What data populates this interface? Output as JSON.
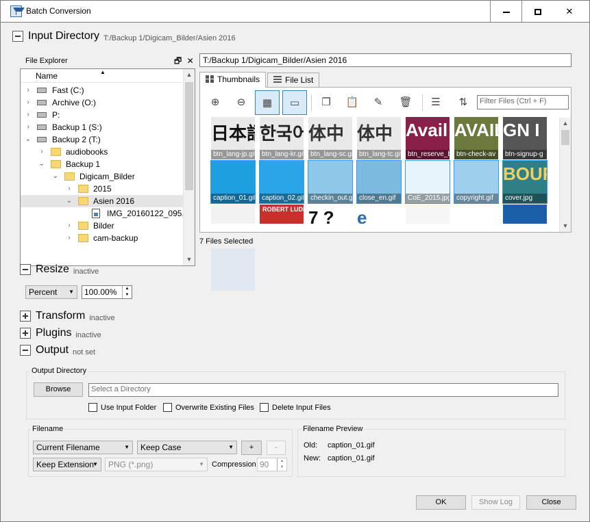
{
  "window": {
    "title": "Batch Conversion",
    "min_label": "",
    "close_label": "✕"
  },
  "input_directory": {
    "title": "Input Directory",
    "path": "T:/Backup 1/Digicam_Bilder/Asien 2016"
  },
  "file_explorer": {
    "label": "File Explorer",
    "column_header": "Name",
    "items": [
      {
        "label": "Fast (C:)",
        "type": "drive"
      },
      {
        "label": "Archive (O:)",
        "type": "drive"
      },
      {
        "label": "P:",
        "type": "drive"
      },
      {
        "label": "Backup 1 (S:)",
        "type": "drive"
      },
      {
        "label": "Backup 2 (T:)",
        "type": "drive"
      },
      {
        "label": "audiobooks",
        "type": "folder"
      },
      {
        "label": "Backup 1",
        "type": "folder"
      },
      {
        "label": "Digicam_Bilder",
        "type": "folder"
      },
      {
        "label": "2015",
        "type": "folder"
      },
      {
        "label": "Asien 2016",
        "type": "folder",
        "selected": true
      },
      {
        "label": "IMG_20160122_095...",
        "type": "file"
      },
      {
        "label": "Bilder",
        "type": "folder"
      },
      {
        "label": "cam-backup",
        "type": "folder"
      }
    ]
  },
  "path_field": "T:/Backup 1/Digicam_Bilder/Asien 2016",
  "tabs": [
    {
      "label": "Thumbnails",
      "active": true
    },
    {
      "label": "File List",
      "active": false
    }
  ],
  "toolbar": {
    "icons": [
      "zoom-in-icon",
      "zoom-out-icon",
      "grid-view-icon",
      "single-view-icon",
      "copy-icon",
      "paste-icon",
      "edit-icon",
      "delete-icon",
      "list-icon",
      "sort-icon"
    ],
    "filter_placeholder": "Filter Files (Ctrl + F)"
  },
  "thumbnails": [
    {
      "caption": "btn_lang-jp.gif",
      "text": "日本語",
      "bg": "#e9e9e9",
      "fg": "#111111"
    },
    {
      "caption": "btn_lang-kr.gif",
      "text": "한국어",
      "bg": "#e9e9e9",
      "fg": "#222222"
    },
    {
      "caption": "btn_lang-sc.gif",
      "text": "体中",
      "bg": "#e9e9e9",
      "fg": "#333333"
    },
    {
      "caption": "btn_lang-tc.gif",
      "text": "体中",
      "bg": "#e9e9e9",
      "fg": "#333333"
    },
    {
      "caption": "btn_reserve_b",
      "text": "Avail",
      "bg": "#8a1f4a",
      "fg": "#ffffff"
    },
    {
      "caption": "btn-check-av",
      "text": "AVAIL",
      "bg": "#6b7a3c",
      "fg": "#ffffff"
    },
    {
      "caption": "btn-signup-g",
      "text": "GN I",
      "bg": "#555555",
      "fg": "#ffffff"
    },
    {
      "caption": "caption_01.gif",
      "text": "",
      "bg": "#1e9fe0",
      "fg": "#ffffff"
    },
    {
      "caption": "caption_02.gif",
      "text": "",
      "bg": "#2aa5e5",
      "fg": "#ffffff"
    },
    {
      "caption": "checkin_out.gif",
      "text": "",
      "bg": "#8dc8e8",
      "fg": "#ffffff"
    },
    {
      "caption": "close_en.gif",
      "text": "",
      "bg": "#7cbbe0",
      "fg": "#ffffff"
    },
    {
      "caption": "CoE_2015.jpg",
      "text": "",
      "bg": "#e6f3f8",
      "fg": "#333333"
    },
    {
      "caption": "copyright.gif",
      "text": "",
      "bg": "#9ed0ee",
      "fg": "#ffffff"
    },
    {
      "caption": "cover.jpg",
      "text": "BOURNE",
      "bg": "#2f7f86",
      "fg": "#f0d060"
    },
    {
      "caption": "",
      "text": "",
      "bg": "#f2f2f2",
      "fg": "#c0392b"
    },
    {
      "caption": "",
      "text": "ROBERT LUDLUMS",
      "bg": "#c9302c",
      "fg": "#ffffff"
    },
    {
      "caption": "",
      "text": "7 ?",
      "bg": "#ffffff",
      "fg": "#111111"
    },
    {
      "caption": "",
      "text": "e",
      "bg": "#ffffff",
      "fg": "#2a6fb0"
    },
    {
      "caption": "",
      "text": "",
      "bg": "#f5f5f5",
      "fg": "#888888"
    },
    {
      "caption": "",
      "text": "",
      "bg": "#ffffff",
      "fg": "#333333"
    },
    {
      "caption": "",
      "text": "",
      "bg": "#1b5fa8",
      "fg": "#ffffff"
    },
    {
      "caption": "",
      "text": "",
      "bg": "#dfe8ef",
      "fg": "#333333"
    }
  ],
  "files_selected": "7 Files Selected",
  "resize": {
    "title": "Resize",
    "status": "inactive",
    "unit": "Percent",
    "value": "100.00%"
  },
  "transform": {
    "title": "Transform",
    "status": "inactive"
  },
  "plugins": {
    "title": "Plugins",
    "status": "inactive"
  },
  "output": {
    "title": "Output",
    "status": "not set"
  },
  "output_directory": {
    "label": "Output Directory",
    "browse": "Browse",
    "placeholder": "Select a Directory",
    "checkboxes": [
      "Use Input Folder",
      "Overwrite Existing Files",
      "Delete Input Files"
    ]
  },
  "filename": {
    "label": "Filename",
    "name_mode": "Current Filename",
    "case_mode": "Keep Case",
    "plus": "+",
    "minus": "-",
    "extension_mode": "Keep Extension",
    "format": "PNG (*.png)",
    "compression_label": "Compression",
    "compression": "90"
  },
  "preview": {
    "label": "Filename Preview",
    "old_label": "Old:",
    "old_value": "caption_01.gif",
    "new_label": "New:",
    "new_value": "caption_01.gif"
  },
  "buttons": {
    "ok": "OK",
    "show_log": "Show Log",
    "close": "Close"
  }
}
